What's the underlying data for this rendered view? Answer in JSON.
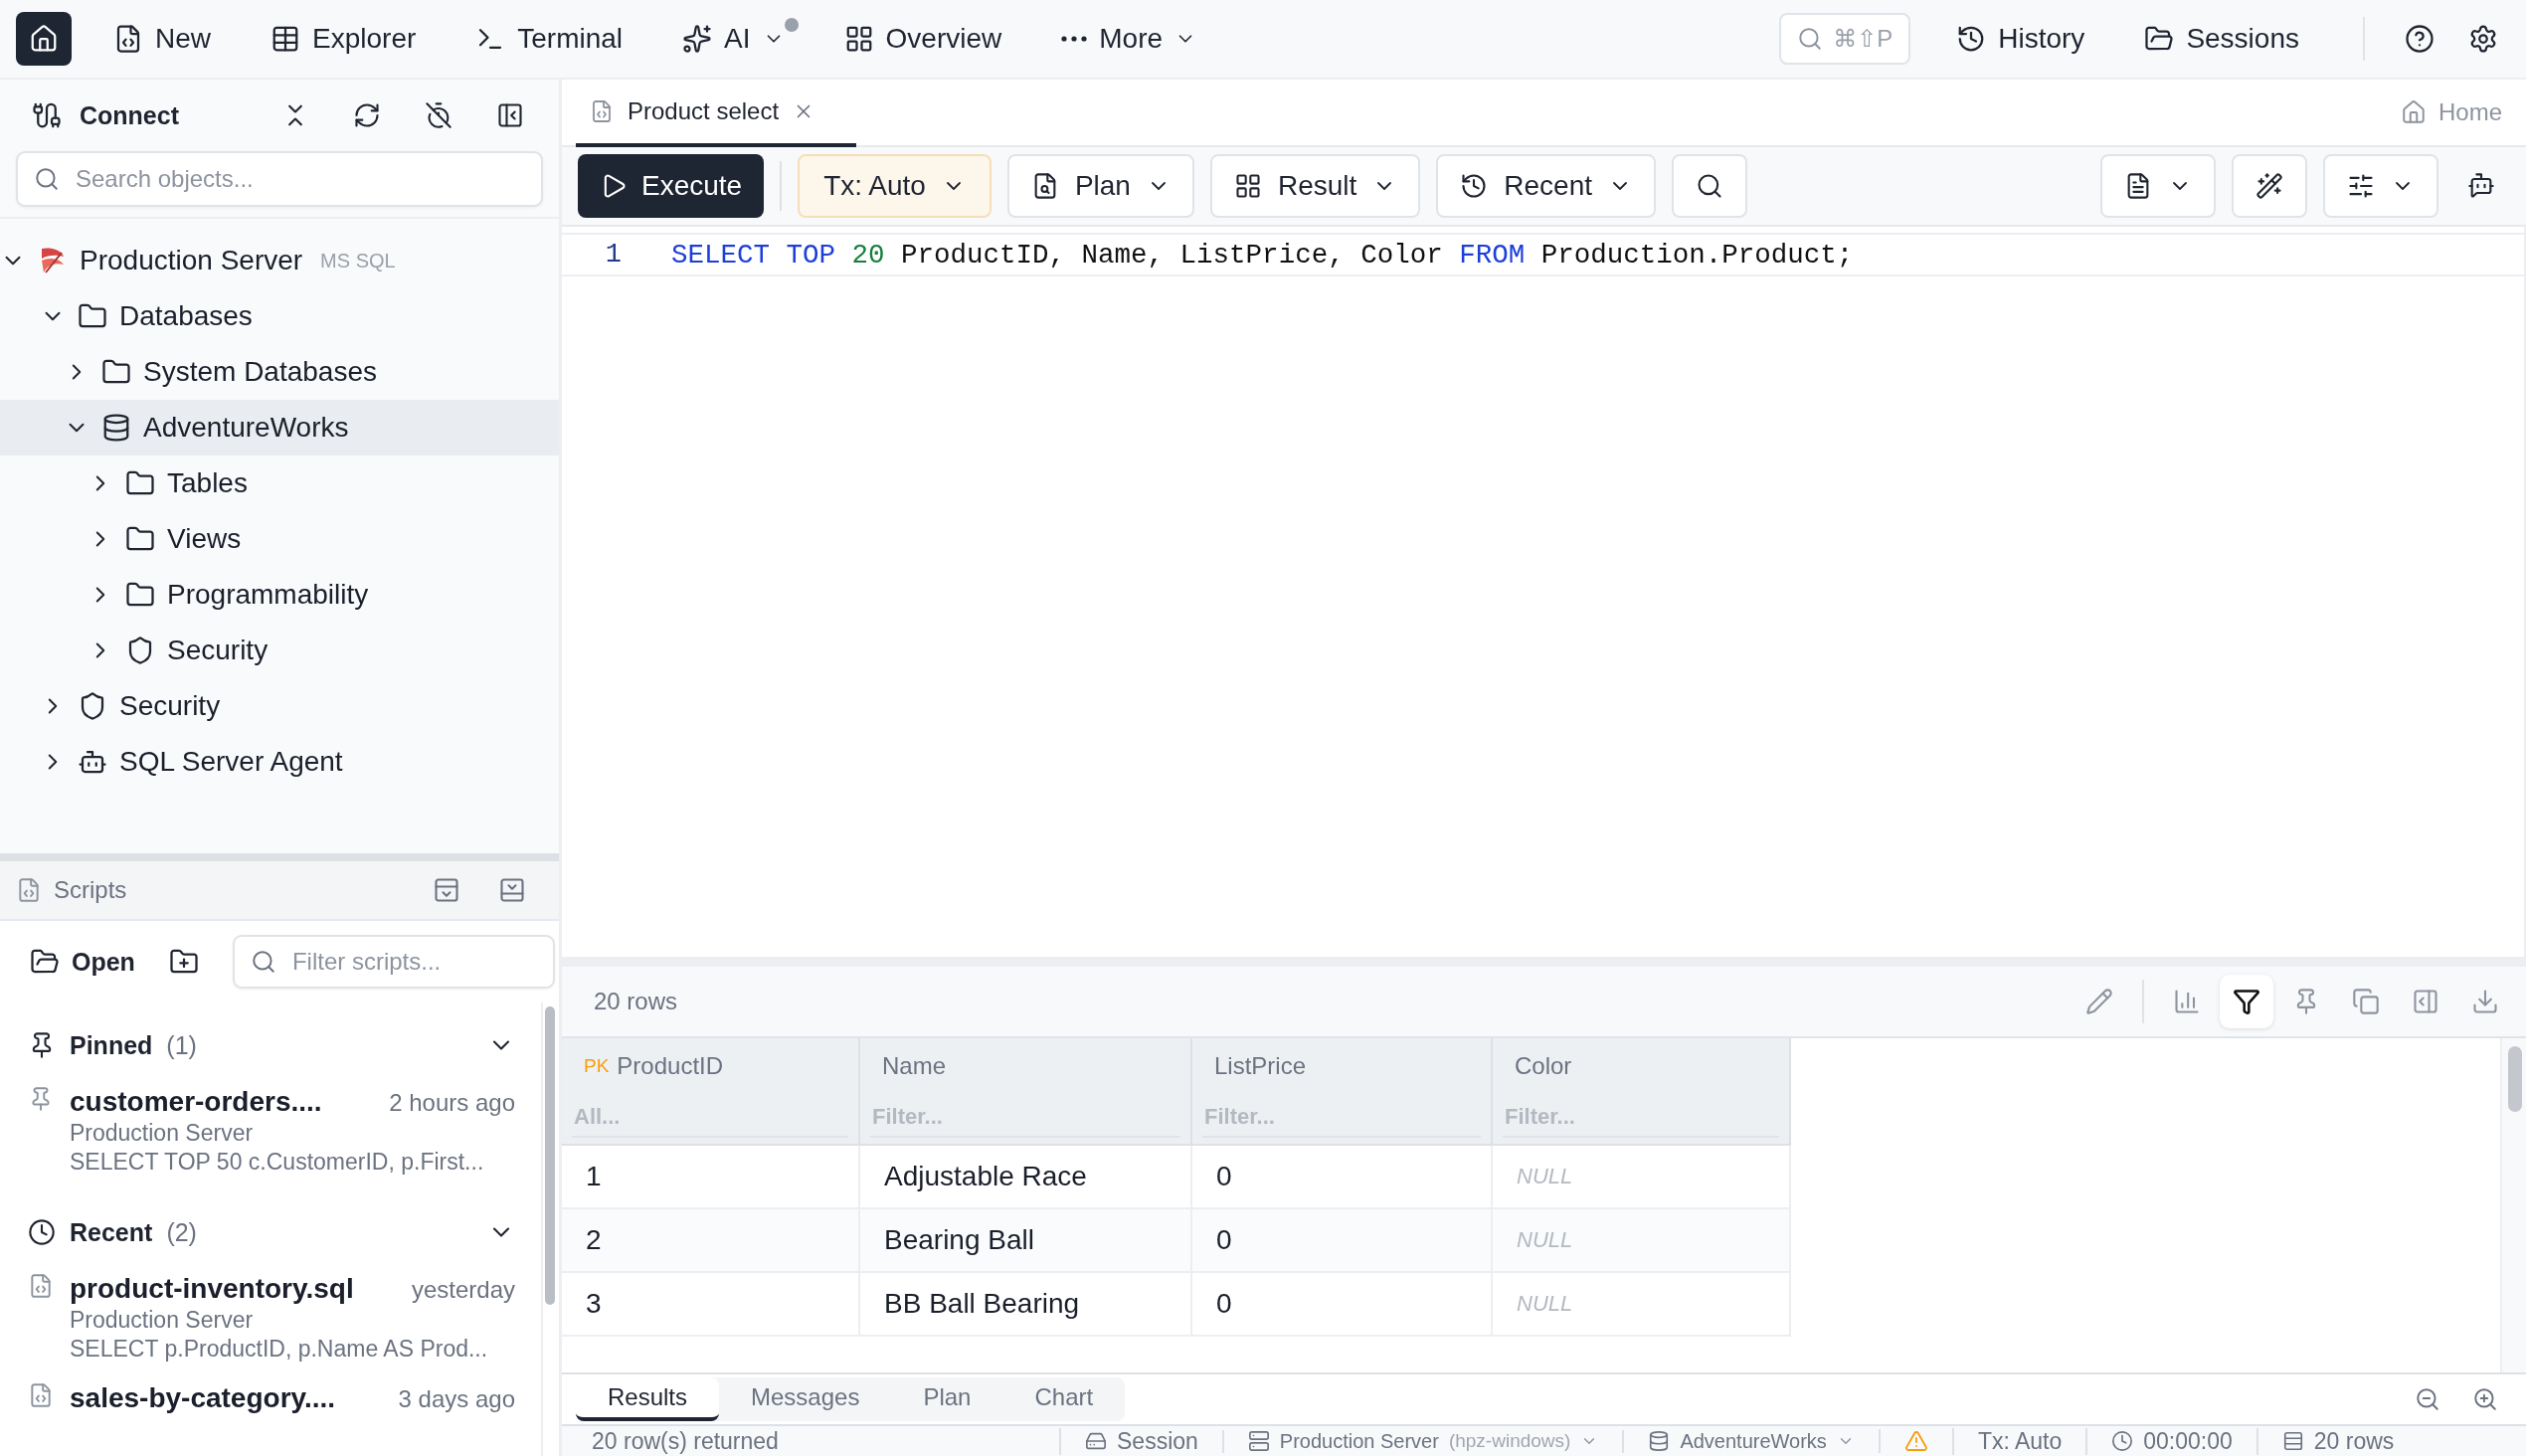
{
  "top_nav": {
    "items": [
      {
        "label": "New",
        "has_menu": false,
        "badge_dot": false
      },
      {
        "label": "Explorer",
        "has_menu": false,
        "badge_dot": false
      },
      {
        "label": "Terminal",
        "has_menu": false,
        "badge_dot": false
      },
      {
        "label": "AI",
        "has_menu": true,
        "badge_dot": true
      },
      {
        "label": "Overview",
        "has_menu": false,
        "badge_dot": false
      },
      {
        "label": "More",
        "has_menu": true,
        "badge_dot": false
      }
    ],
    "search_shortcut": "⌘⇧P",
    "right_items": [
      {
        "label": "History"
      },
      {
        "label": "Sessions"
      }
    ]
  },
  "sidebar": {
    "connect_label": "Connect",
    "search": {
      "placeholder": "Search objects..."
    },
    "tree": [
      {
        "label": "Production Server",
        "badge": "MS SQL",
        "kind": "server",
        "expanded": true,
        "selected": false,
        "children": [
          {
            "label": "Databases",
            "kind": "folder",
            "expanded": true,
            "selected": false,
            "children": [
              {
                "label": "System Databases",
                "kind": "folder",
                "expanded": false,
                "selected": false
              },
              {
                "label": "AdventureWorks",
                "kind": "database",
                "expanded": true,
                "selected": true,
                "children": [
                  {
                    "label": "Tables",
                    "kind": "folder",
                    "expanded": false,
                    "selected": false
                  },
                  {
                    "label": "Views",
                    "kind": "folder",
                    "expanded": false,
                    "selected": false
                  },
                  {
                    "label": "Programmability",
                    "kind": "folder",
                    "expanded": false,
                    "selected": false
                  },
                  {
                    "label": "Security",
                    "kind": "security",
                    "expanded": false,
                    "selected": false
                  }
                ]
              }
            ]
          },
          {
            "label": "Security",
            "kind": "security",
            "expanded": false,
            "selected": false
          },
          {
            "label": "SQL Server Agent",
            "kind": "agent",
            "expanded": false,
            "selected": false
          }
        ]
      }
    ]
  },
  "scripts": {
    "title": "Scripts",
    "open_label": "Open",
    "filter": {
      "placeholder": "Filter scripts..."
    },
    "groups": [
      {
        "kind": "pinned",
        "label": "Pinned",
        "count": "(1)",
        "expanded": true,
        "items": [
          {
            "name": "customer-orders....",
            "time": "2 hours ago",
            "server": "Production Server",
            "preview": "SELECT TOP 50 c.CustomerID, p.First..."
          }
        ]
      },
      {
        "kind": "recent",
        "label": "Recent",
        "count": "(2)",
        "expanded": true,
        "items": [
          {
            "name": "product-inventory.sql",
            "time": "yesterday",
            "server": "Production Server",
            "preview": "SELECT p.ProductID, p.Name AS Prod..."
          },
          {
            "name": "sales-by-category....",
            "time": "3 days ago"
          }
        ]
      }
    ]
  },
  "editor": {
    "tabs": [
      {
        "label": "Product select",
        "selected": true
      }
    ],
    "home_label": "Home",
    "toolbar": {
      "execute": "Execute",
      "tx": "Tx: Auto",
      "plan": "Plan",
      "result": "Result",
      "recent": "Recent"
    },
    "lines": [
      {
        "number": "1",
        "tokens": [
          {
            "text": "SELECT",
            "kind": "keyword"
          },
          {
            "text": " TOP",
            "kind": "keyword"
          },
          {
            "text": " 20",
            "kind": "number"
          },
          {
            "text": " ProductID, Name, ListPrice, Color ",
            "kind": "plain"
          },
          {
            "text": "FROM",
            "kind": "keyword"
          },
          {
            "text": " Production.Product;",
            "kind": "plain"
          }
        ]
      }
    ]
  },
  "results": {
    "row_count": "20 rows",
    "tools": [
      {
        "selected": false
      },
      {
        "selected": false
      },
      {
        "selected": true
      },
      {
        "selected": false
      },
      {
        "selected": false
      },
      {
        "selected": false
      },
      {
        "selected": false
      }
    ],
    "columns": [
      {
        "label": "ProductID",
        "pk": "PK",
        "filter_placeholder": "All..."
      },
      {
        "label": "Name",
        "filter_placeholder": "Filter..."
      },
      {
        "label": "ListPrice",
        "filter_placeholder": "Filter..."
      },
      {
        "label": "Color",
        "filter_placeholder": "Filter..."
      }
    ],
    "rows": [
      {
        "cells": [
          {
            "text": "1",
            "is_null": false
          },
          {
            "text": "Adjustable Race",
            "is_null": false
          },
          {
            "text": "0",
            "is_null": false
          },
          {
            "text": "NULL",
            "is_null": true
          }
        ]
      },
      {
        "cells": [
          {
            "text": "2",
            "is_null": false
          },
          {
            "text": "Bearing Ball",
            "is_null": false
          },
          {
            "text": "0",
            "is_null": false
          },
          {
            "text": "NULL",
            "is_null": true
          }
        ]
      },
      {
        "cells": [
          {
            "text": "3",
            "is_null": false
          },
          {
            "text": "BB Ball Bearing",
            "is_null": false
          },
          {
            "text": "0",
            "is_null": false
          },
          {
            "text": "NULL",
            "is_null": true
          }
        ]
      }
    ],
    "tabs": [
      {
        "label": "Results",
        "selected": true
      },
      {
        "label": "Messages",
        "selected": false
      },
      {
        "label": "Plan",
        "selected": false
      },
      {
        "label": "Chart",
        "selected": false
      }
    ]
  },
  "status_bar": {
    "summary": "20 row(s) returned",
    "session": "Session",
    "server": "Production Server",
    "host": "(hpz-windows)",
    "database": "AdventureWorks",
    "warning": true,
    "tx": "Tx: Auto",
    "elapsed": "00:00:00",
    "rows": "20 rows"
  }
}
